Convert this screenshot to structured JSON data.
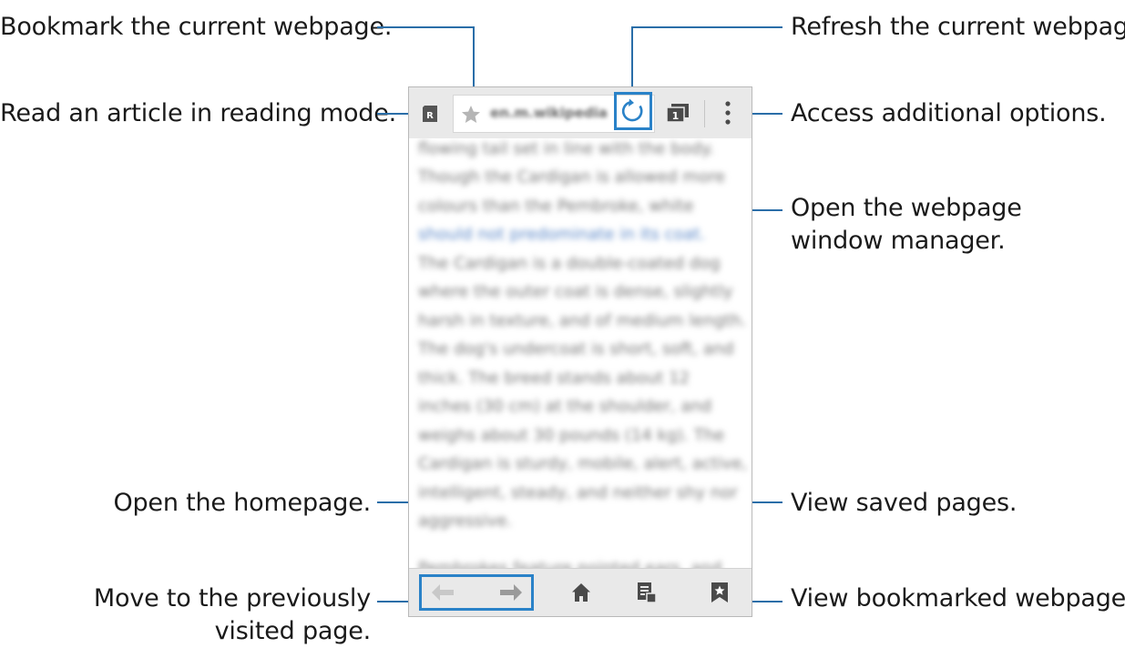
{
  "callouts": {
    "bookmark": "Bookmark the current webpage.",
    "reading_mode": "Read an article in reading mode.",
    "refresh": "Refresh the current webpage.",
    "options": "Access additional options.",
    "window_manager": "Open the webpage window manager.",
    "homepage": "Open the homepage.",
    "back_forward": "Move to the previously visited page.",
    "saved_pages": "View saved pages.",
    "bookmarks": "View bookmarked webpages."
  },
  "browser": {
    "url": "en.m.wikipedia",
    "reading_icon_letter": "R",
    "tab_count": "1",
    "article_lines": [
      "flowing tail set in line with the body.",
      "Though the Cardigan is allowed more",
      "colours than the Pembroke, white",
      "should not predominate in its coat.",
      "The Cardigan is a double-coated dog",
      "where the outer coat is dense, slightly",
      "harsh in texture, and of medium length.",
      "The dog's undercoat is short, soft, and",
      "thick. The breed stands about 12",
      "inches (30 cm) at the shoulder, and",
      "weighs about 30 pounds (14 kg). The",
      "Cardigan is sturdy, mobile, alert, active,",
      "intelligent, steady, and neither shy nor",
      "aggressive.",
      "",
      "Pembrokes feature pointed ears, and"
    ]
  },
  "colors": {
    "accent": "#2a82c8",
    "leader_line": "#2a6ea8"
  }
}
